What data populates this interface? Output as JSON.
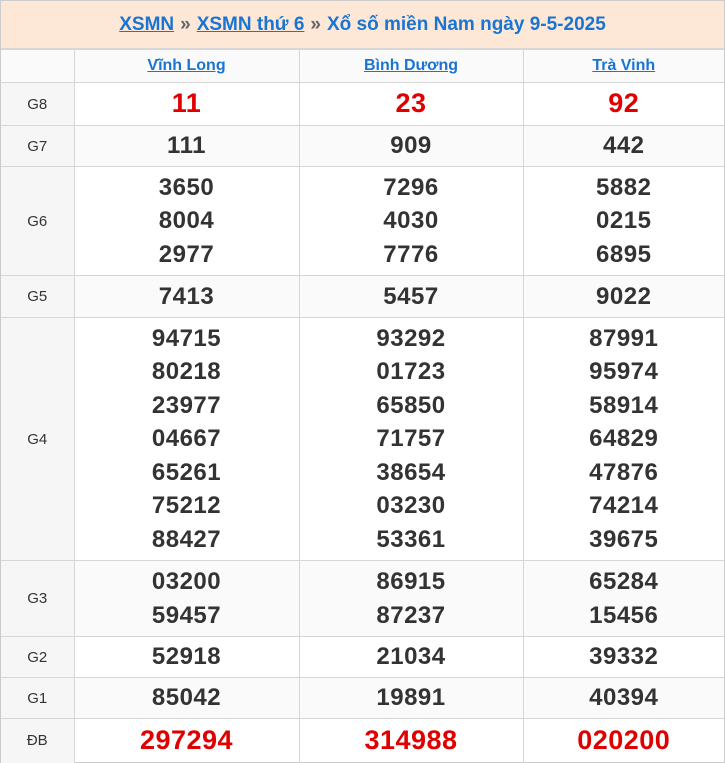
{
  "breadcrumb": {
    "link1": "XSMN",
    "sep1": "»",
    "link2": "XSMN thứ 6",
    "sep2": "»",
    "title": "Xổ số miền Nam ngày 9-5-2025"
  },
  "provinces": [
    "Vĩnh Long",
    "Bình Dương",
    "Trà Vinh"
  ],
  "prizes": [
    {
      "label": "G8",
      "values": [
        [
          "11"
        ],
        [
          "23"
        ],
        [
          "92"
        ]
      ]
    },
    {
      "label": "G7",
      "values": [
        [
          "111"
        ],
        [
          "909"
        ],
        [
          "442"
        ]
      ]
    },
    {
      "label": "G6",
      "values": [
        [
          "3650",
          "8004",
          "2977"
        ],
        [
          "7296",
          "4030",
          "7776"
        ],
        [
          "5882",
          "0215",
          "6895"
        ]
      ]
    },
    {
      "label": "G5",
      "values": [
        [
          "7413"
        ],
        [
          "5457"
        ],
        [
          "9022"
        ]
      ]
    },
    {
      "label": "G4",
      "values": [
        [
          "94715",
          "80218",
          "23977",
          "04667",
          "65261",
          "75212",
          "88427"
        ],
        [
          "93292",
          "01723",
          "65850",
          "71757",
          "38654",
          "03230",
          "53361"
        ],
        [
          "87991",
          "95974",
          "58914",
          "64829",
          "47876",
          "74214",
          "39675"
        ]
      ]
    },
    {
      "label": "G3",
      "values": [
        [
          "03200",
          "59457"
        ],
        [
          "86915",
          "87237"
        ],
        [
          "65284",
          "15456"
        ]
      ]
    },
    {
      "label": "G2",
      "values": [
        [
          "52918"
        ],
        [
          "21034"
        ],
        [
          "39332"
        ]
      ]
    },
    {
      "label": "G1",
      "values": [
        [
          "85042"
        ],
        [
          "19891"
        ],
        [
          "40394"
        ]
      ]
    },
    {
      "label": "ĐB",
      "values": [
        [
          "297294"
        ],
        [
          "314988"
        ],
        [
          "020200"
        ]
      ]
    }
  ],
  "colors": {
    "link": "#1a75d2",
    "highlight": "#e00000",
    "header_bg": "#fde7d6"
  }
}
